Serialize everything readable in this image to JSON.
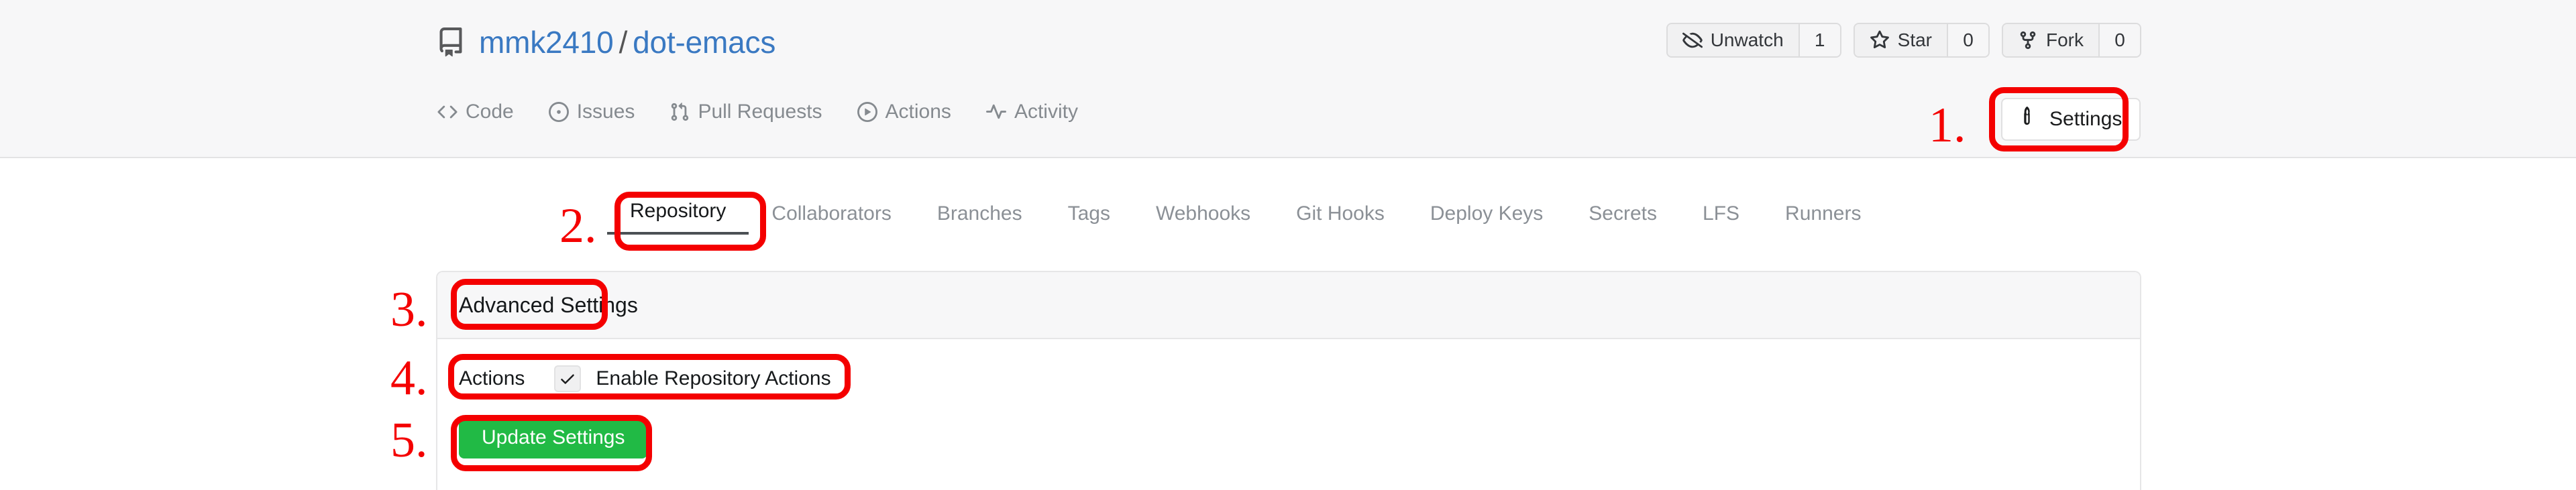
{
  "repo": {
    "icon": "repository-book-icon",
    "owner": "mmk2410",
    "separator": "/",
    "name": "dot-emacs"
  },
  "repo_actions": [
    {
      "icon": "eye-slash-icon",
      "label": "Unwatch",
      "count": "1"
    },
    {
      "icon": "star-icon",
      "label": "Star",
      "count": "0"
    },
    {
      "icon": "fork-icon",
      "label": "Fork",
      "count": "0"
    }
  ],
  "nav_tabs": [
    {
      "icon": "code-icon",
      "label": "Code"
    },
    {
      "icon": "issue-opened-icon",
      "label": "Issues"
    },
    {
      "icon": "git-pull-request-icon",
      "label": "Pull Requests"
    },
    {
      "icon": "play-circle-icon",
      "label": "Actions"
    },
    {
      "icon": "pulse-icon",
      "label": "Activity"
    }
  ],
  "settings_button": {
    "icon": "wrench-icon",
    "label": "Settings"
  },
  "subtabs": [
    {
      "label": "Repository",
      "active": true
    },
    {
      "label": "Collaborators",
      "active": false
    },
    {
      "label": "Branches",
      "active": false
    },
    {
      "label": "Tags",
      "active": false
    },
    {
      "label": "Webhooks",
      "active": false
    },
    {
      "label": "Git Hooks",
      "active": false
    },
    {
      "label": "Deploy Keys",
      "active": false
    },
    {
      "label": "Secrets",
      "active": false
    },
    {
      "label": "LFS",
      "active": false
    },
    {
      "label": "Runners",
      "active": false
    }
  ],
  "panel": {
    "title": "Advanced Settings",
    "actions_field_label": "Actions",
    "enable_actions_label": "Enable Repository Actions",
    "enable_actions_checked": true,
    "update_button_label": "Update Settings"
  },
  "annotations": [
    {
      "number": "1."
    },
    {
      "number": "2."
    },
    {
      "number": "3."
    },
    {
      "number": "4."
    },
    {
      "number": "5."
    }
  ],
  "colors": {
    "link": "#3a79c2",
    "annotation_red": "#f40000",
    "primary_green": "#21ba45",
    "header_bg": "#f7f7f8"
  }
}
